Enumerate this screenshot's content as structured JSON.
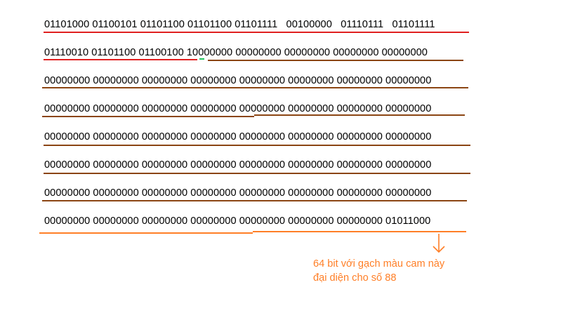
{
  "rows": [
    "01101000 01100101 01101100 01101100 01101111   00100000   01110111   01101111",
    "01110010 01101100 01100100 10000000 00000000 00000000 00000000 00000000",
    "00000000 00000000 00000000 00000000 00000000 00000000 00000000 00000000",
    "00000000 00000000 00000000 00000000 00000000 00000000 00000000 00000000",
    "00000000 00000000 00000000 00000000 00000000 00000000 00000000 00000000",
    "00000000 00000000 00000000 00000000 00000000 00000000 00000000 00000000",
    "00000000 00000000 00000000 00000000 00000000 00000000 00000000 00000000",
    "00000000 00000000 00000000 00000000 00000000 00000000 00000000 01011000"
  ],
  "note": {
    "line1": "64 bit với gạch màu cam này",
    "line2": "đại diện cho số 88"
  },
  "colors": {
    "message": "#e02020",
    "padding": "#8b4513",
    "length": "#ff7f27",
    "boundary": "#22c55e"
  }
}
